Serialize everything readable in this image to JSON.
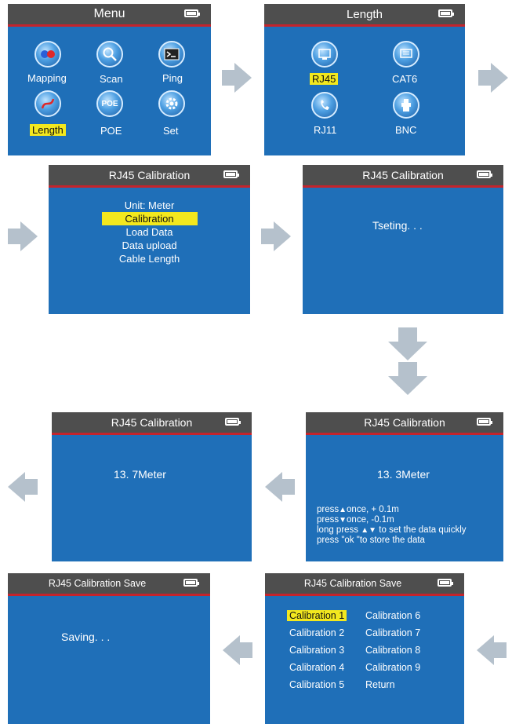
{
  "screens": {
    "menu": {
      "title": "Menu",
      "items": [
        {
          "label": "Mapping",
          "icon": "mapping-icon"
        },
        {
          "label": "Scan",
          "icon": "scan-icon"
        },
        {
          "label": "Ping",
          "icon": "ping-icon"
        },
        {
          "label": "Length",
          "icon": "length-icon",
          "selected": true
        },
        {
          "label": "POE",
          "icon": "poe-icon"
        },
        {
          "label": "Set",
          "icon": "set-icon"
        }
      ]
    },
    "length": {
      "title": "Length",
      "items": [
        {
          "label": "RJ45",
          "icon": "rj45-icon",
          "selected": true
        },
        {
          "label": "CAT6",
          "icon": "cat6-icon"
        },
        {
          "label": "RJ11",
          "icon": "rj11-icon"
        },
        {
          "label": "BNC",
          "icon": "bnc-icon"
        }
      ]
    },
    "calib_menu": {
      "title": "RJ45  Calibration",
      "items": [
        "Unit: Meter",
        "Calibration",
        "Load Data",
        "Data  upload",
        "Cable  Length"
      ],
      "selected_index": 1
    },
    "testing": {
      "title": "RJ45  Calibration",
      "message": "Tseting. . ."
    },
    "result_137": {
      "title": "RJ45  Calibration",
      "value": "13. 7Meter"
    },
    "result_133": {
      "title": "RJ45  Calibration",
      "value": "13. 3Meter",
      "instructions": [
        "press",
        "once, + 0.1m",
        "press",
        "once, -0.1m",
        "long press",
        "to set the data quickly",
        "press \"ok \"to store the data"
      ]
    },
    "saving": {
      "title": "RJ45 Calibration Save",
      "message": "Saving. . ."
    },
    "save_menu": {
      "title": "RJ45 Calibration Save",
      "left": [
        "Calibration  1",
        "Calibration  2",
        "Calibration  3",
        "Calibration  4",
        "Calibration  5"
      ],
      "right": [
        "Calibration  6",
        "Calibration  7",
        "Calibration  8",
        "Calibration  9",
        "Return"
      ],
      "selected": "Calibration  1"
    }
  },
  "colors": {
    "screen_bg": "#1f6fb8",
    "titlebar_bg": "#4e4e4e",
    "title_underline": "#c4242c",
    "highlight": "#f3e81e",
    "arrow": "#b5c1cc"
  }
}
